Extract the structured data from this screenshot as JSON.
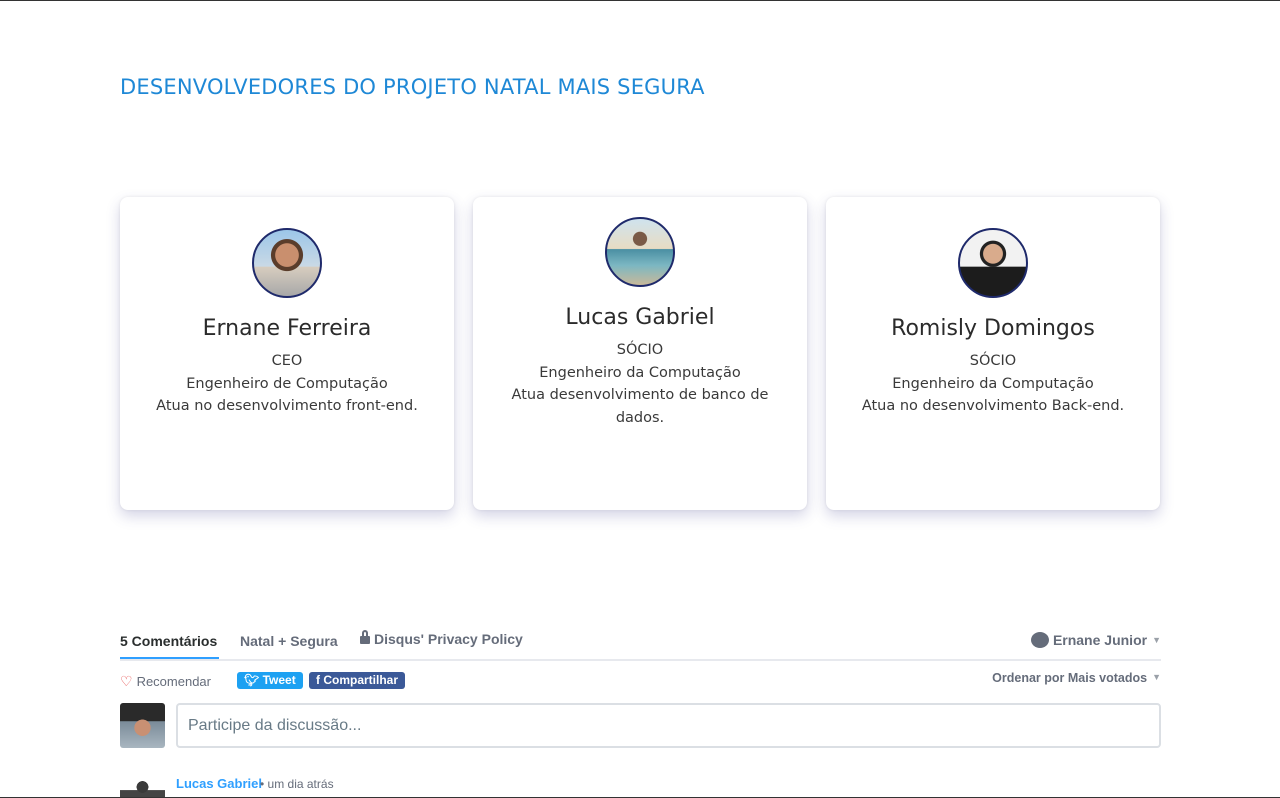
{
  "section": {
    "title": "DESENVOLVEDORES DO PROJETO NATAL MAIS SEGURA"
  },
  "team": [
    {
      "name": "Ernane Ferreira",
      "role": "CEO",
      "degree": "Engenheiro de Computação",
      "desc": "Atua no desenvolvimento front-end."
    },
    {
      "name": "Lucas Gabriel",
      "role": "SÓCIO",
      "degree": "Engenheiro da Computação",
      "desc": "Atua desenvolvimento de banco de dados."
    },
    {
      "name": "Romisly Domingos",
      "role": "SÓCIO",
      "degree": "Engenheiro da Computação",
      "desc": "Atua no desenvolvimento Back-end."
    }
  ],
  "disqus": {
    "tabs": {
      "comments": "5 Comentários",
      "community": "Natal + Segura",
      "privacy": "Disqus' Privacy Policy"
    },
    "user": "Ernane Junior",
    "recommend": "Recomendar",
    "tweet": "Tweet",
    "share": "Compartilhar",
    "sort_prefix": "Ordenar por",
    "sort_value": "Mais votados",
    "compose_placeholder": "Participe da discussão...",
    "first_comment": {
      "author": "Lucas Gabriel",
      "time": "• um dia atrás"
    },
    "colors": {
      "accent": "#2e9fff",
      "twitter": "#1da1f2",
      "facebook": "#3b5998",
      "title": "#1e88d6"
    }
  }
}
